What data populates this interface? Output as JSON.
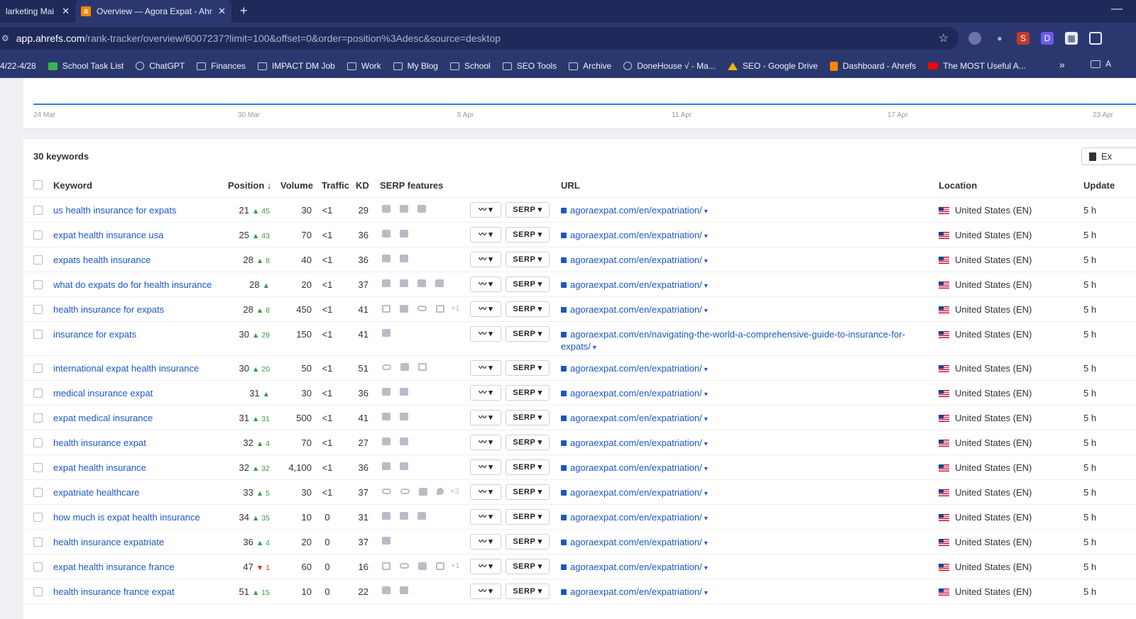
{
  "browser": {
    "tabs": [
      {
        "title": "larketing Mai",
        "active": false
      },
      {
        "title": "Overview — Agora Expat - Ahr",
        "active": true
      }
    ],
    "new_tab_label": "+",
    "minimize_label": "—",
    "url_host": "app.ahrefs.com",
    "url_path": "/rank-tracker/overview/6007237?limit=100&offset=0&order=position%3Adesc&source=desktop",
    "bookmarks": [
      {
        "label": "4/22-4/28",
        "icon": "none"
      },
      {
        "label": "School Task List",
        "icon": "sheets-icon"
      },
      {
        "label": "ChatGPT",
        "icon": "chatgpt-icon"
      },
      {
        "label": "Finances",
        "icon": "folder-icon"
      },
      {
        "label": "IMPACT DM Job",
        "icon": "folder-icon"
      },
      {
        "label": "Work",
        "icon": "folder-icon"
      },
      {
        "label": "My Blog",
        "icon": "folder-icon"
      },
      {
        "label": "School",
        "icon": "folder-icon"
      },
      {
        "label": "SEO Tools",
        "icon": "folder-icon"
      },
      {
        "label": "Archive",
        "icon": "folder-icon"
      },
      {
        "label": "DoneHouse √ - Ma...",
        "icon": "globe-icon"
      },
      {
        "label": "SEO - Google Drive",
        "icon": "drive-icon"
      },
      {
        "label": "Dashboard - Ahrefs",
        "icon": "ahrefs-icon"
      },
      {
        "label": "The MOST Useful A...",
        "icon": "youtube-icon"
      }
    ],
    "bookmarks_more": "»",
    "bookmarks_end_label": "A"
  },
  "chart": {
    "x_ticks": [
      "24 Mar",
      "30 Mar",
      "5 Apr",
      "11 Apr",
      "17 Apr",
      "23 Apr"
    ]
  },
  "table": {
    "count_title": "30 keywords",
    "export_label": "Ex",
    "headers": {
      "keyword": "Keyword",
      "position": "Position ↓",
      "volume": "Volume",
      "traffic": "Traffic",
      "kd": "KD",
      "serp_features": "SERP features",
      "url": "URL",
      "location": "Location",
      "updated": "Update"
    },
    "trend_button_label": "〰 ▾",
    "serp_button_label": "SERP ▾",
    "rows": [
      {
        "keyword": "us health insurance for expats",
        "position": "21",
        "change": "▲ 45",
        "dir": "up",
        "volume": "30",
        "traffic": "<1",
        "kd": "29",
        "serp": [
          "sitelink",
          "discussion",
          "video"
        ],
        "url": "agoraexpat.com/en/expatriation/",
        "location": "United States (EN)",
        "updated": "5 h"
      },
      {
        "keyword": "expat health insurance usa",
        "position": "25",
        "change": "▲ 43",
        "dir": "up",
        "volume": "70",
        "traffic": "<1",
        "kd": "36",
        "serp": [
          "sitelink",
          "video"
        ],
        "url": "agoraexpat.com/en/expatriation/",
        "location": "United States (EN)",
        "updated": "5 h"
      },
      {
        "keyword": "expats health insurance",
        "position": "28",
        "change": "▲ 8",
        "dir": "up",
        "volume": "40",
        "traffic": "<1",
        "kd": "36",
        "serp": [
          "sitelink",
          "video"
        ],
        "url": "agoraexpat.com/en/expatriation/",
        "location": "United States (EN)",
        "updated": "5 h"
      },
      {
        "keyword": "what do expats do for health insurance",
        "position": "28",
        "change": "▲",
        "dir": "up",
        "volume": "20",
        "traffic": "<1",
        "kd": "37",
        "serp": [
          "sitelink",
          "discussion",
          "quote",
          "video"
        ],
        "url": "agoraexpat.com/en/expatriation/",
        "location": "United States (EN)",
        "updated": "5 h"
      },
      {
        "keyword": "health insurance for expats",
        "position": "28",
        "change": "▲ 8",
        "dir": "up",
        "volume": "450",
        "traffic": "<1",
        "kd": "41",
        "serp": [
          "image",
          "sitelink",
          "link",
          "ad"
        ],
        "serp_more": "+1",
        "url": "agoraexpat.com/en/expatriation/",
        "location": "United States (EN)",
        "updated": "5 h"
      },
      {
        "keyword": "insurance for expats",
        "position": "30",
        "change": "▲ 29",
        "dir": "up",
        "volume": "150",
        "traffic": "<1",
        "kd": "41",
        "serp": [
          "sitelink"
        ],
        "url": "agoraexpat.com/en/navigating-the-world-a-comprehensive-guide-to-insurance-for-expats/",
        "location": "United States (EN)",
        "updated": "5 h",
        "tall": true
      },
      {
        "keyword": "international expat health insurance",
        "position": "30",
        "change": "▲ 20",
        "dir": "up",
        "volume": "50",
        "traffic": "<1",
        "kd": "51",
        "serp": [
          "link",
          "sitelink",
          "ad"
        ],
        "url": "agoraexpat.com/en/expatriation/",
        "location": "United States (EN)",
        "updated": "5 h"
      },
      {
        "keyword": "medical insurance expat",
        "position": "31",
        "change": "▲",
        "dir": "up",
        "volume": "30",
        "traffic": "<1",
        "kd": "36",
        "serp": [
          "sitelink",
          "shopping"
        ],
        "url": "agoraexpat.com/en/expatriation/",
        "location": "United States (EN)",
        "updated": "5 h"
      },
      {
        "keyword": "expat medical insurance",
        "position": "31",
        "change": "▲ 31",
        "dir": "up",
        "volume": "500",
        "traffic": "<1",
        "kd": "41",
        "serp": [
          "sitelink",
          "video"
        ],
        "url": "agoraexpat.com/en/expatriation/",
        "location": "United States (EN)",
        "updated": "5 h"
      },
      {
        "keyword": "health insurance expat",
        "position": "32",
        "change": "▲ 4",
        "dir": "up",
        "volume": "70",
        "traffic": "<1",
        "kd": "27",
        "serp": [
          "sitelink",
          "video"
        ],
        "url": "agoraexpat.com/en/expatriation/",
        "location": "United States (EN)",
        "updated": "5 h"
      },
      {
        "keyword": "expat health insurance",
        "position": "32",
        "change": "▲ 32",
        "dir": "up",
        "volume": "4,100",
        "traffic": "<1",
        "kd": "36",
        "serp": [
          "sitelink",
          "video"
        ],
        "url": "agoraexpat.com/en/expatriation/",
        "location": "United States (EN)",
        "updated": "5 h"
      },
      {
        "keyword": "expatriate healthcare",
        "position": "33",
        "change": "▲ 5",
        "dir": "up",
        "volume": "30",
        "traffic": "<1",
        "kd": "37",
        "serp": [
          "link",
          "link",
          "sitelink",
          "pin"
        ],
        "serp_more": "+3",
        "url": "agoraexpat.com/en/expatriation/",
        "location": "United States (EN)",
        "updated": "5 h"
      },
      {
        "keyword": "how much is expat health insurance",
        "position": "34",
        "change": "▲ 35",
        "dir": "up",
        "volume": "10",
        "traffic": "0",
        "kd": "31",
        "serp": [
          "sitelink",
          "quote",
          "video"
        ],
        "url": "agoraexpat.com/en/expatriation/",
        "location": "United States (EN)",
        "updated": "5 h"
      },
      {
        "keyword": "health insurance expatriate",
        "position": "36",
        "change": "▲ 4",
        "dir": "up",
        "volume": "20",
        "traffic": "0",
        "kd": "37",
        "serp": [
          "sitelink"
        ],
        "url": "agoraexpat.com/en/expatriation/",
        "location": "United States (EN)",
        "updated": "5 h"
      },
      {
        "keyword": "expat health insurance france",
        "position": "47",
        "change": "▼ 1",
        "dir": "down",
        "volume": "60",
        "traffic": "0",
        "kd": "16",
        "serp": [
          "image",
          "link",
          "sitelink",
          "ad"
        ],
        "serp_more": "+1",
        "url": "agoraexpat.com/en/expatriation/",
        "location": "United States (EN)",
        "updated": "5 h"
      },
      {
        "keyword": "health insurance france expat",
        "position": "51",
        "change": "▲ 15",
        "dir": "up",
        "volume": "10",
        "traffic": "0",
        "kd": "22",
        "serp": [
          "sitelink",
          "video"
        ],
        "url": "agoraexpat.com/en/expatriation/",
        "location": "United States (EN)",
        "updated": "5 h"
      }
    ]
  }
}
